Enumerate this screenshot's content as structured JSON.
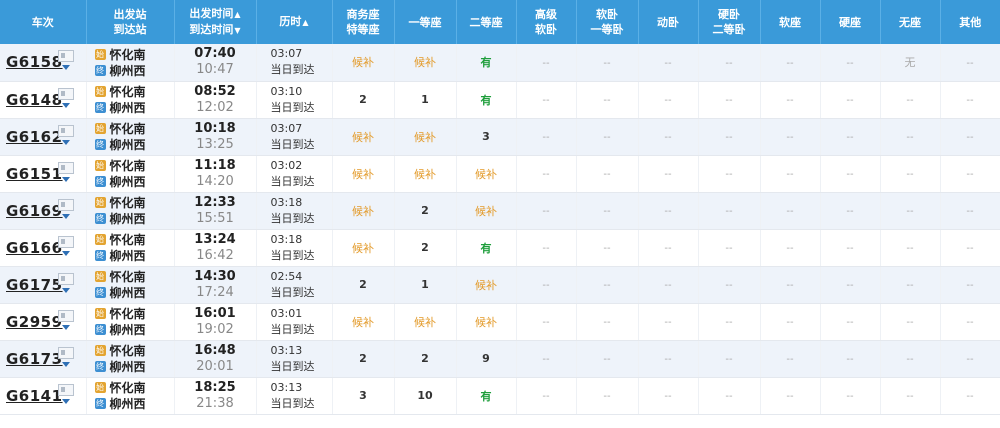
{
  "headers": {
    "train": "车次",
    "station_top": "出发站",
    "station_bottom": "到达站",
    "time_top": "出发时间",
    "time_top_arrow": "▲",
    "time_bottom": "到达时间",
    "time_bottom_arrow": "▼",
    "duration": "历时",
    "duration_arrow": "▲",
    "biz_top": "商务座",
    "biz_bottom": "特等座",
    "first": "一等座",
    "second": "二等座",
    "hsoft_top": "高级",
    "hsoft_bottom": "软卧",
    "soft_top": "软卧",
    "soft_bottom": "一等卧",
    "moving": "动卧",
    "hard_top": "硬卧",
    "hard_bottom": "二等卧",
    "softseat": "软座",
    "hardseat": "硬座",
    "noseat": "无座",
    "other": "其他"
  },
  "trains": [
    {
      "no": "G6158",
      "from": "怀化南",
      "to": "柳州西",
      "from_badge": "始",
      "to_badge": "终",
      "dep": "07:40",
      "arr": "10:47",
      "dur": "03:07",
      "day": "当日到达",
      "biz": "候补",
      "first": "候补",
      "second": "有",
      "hsoft": "--",
      "soft": "--",
      "moving": "--",
      "hard": "--",
      "softseat": "--",
      "hardseat": "--",
      "noseat": "无",
      "other": "--"
    },
    {
      "no": "G6148",
      "from": "怀化南",
      "to": "柳州西",
      "from_badge": "始",
      "to_badge": "终",
      "dep": "08:52",
      "arr": "12:02",
      "dur": "03:10",
      "day": "当日到达",
      "biz": "2",
      "first": "1",
      "second": "有",
      "hsoft": "--",
      "soft": "--",
      "moving": "--",
      "hard": "--",
      "softseat": "--",
      "hardseat": "--",
      "noseat": "--",
      "other": "--"
    },
    {
      "no": "G6162",
      "from": "怀化南",
      "to": "柳州西",
      "from_badge": "始",
      "to_badge": "终",
      "dep": "10:18",
      "arr": "13:25",
      "dur": "03:07",
      "day": "当日到达",
      "biz": "候补",
      "first": "候补",
      "second": "3",
      "hsoft": "--",
      "soft": "--",
      "moving": "--",
      "hard": "--",
      "softseat": "--",
      "hardseat": "--",
      "noseat": "--",
      "other": "--"
    },
    {
      "no": "G6151",
      "from": "怀化南",
      "to": "柳州西",
      "from_badge": "始",
      "to_badge": "终",
      "dep": "11:18",
      "arr": "14:20",
      "dur": "03:02",
      "day": "当日到达",
      "biz": "候补",
      "first": "候补",
      "second": "候补",
      "hsoft": "--",
      "soft": "--",
      "moving": "--",
      "hard": "--",
      "softseat": "--",
      "hardseat": "--",
      "noseat": "--",
      "other": "--"
    },
    {
      "no": "G6169",
      "from": "怀化南",
      "to": "柳州西",
      "from_badge": "始",
      "to_badge": "终",
      "dep": "12:33",
      "arr": "15:51",
      "dur": "03:18",
      "day": "当日到达",
      "biz": "候补",
      "first": "2",
      "second": "候补",
      "hsoft": "--",
      "soft": "--",
      "moving": "--",
      "hard": "--",
      "softseat": "--",
      "hardseat": "--",
      "noseat": "--",
      "other": "--"
    },
    {
      "no": "G6166",
      "from": "怀化南",
      "to": "柳州西",
      "from_badge": "始",
      "to_badge": "终",
      "dep": "13:24",
      "arr": "16:42",
      "dur": "03:18",
      "day": "当日到达",
      "biz": "候补",
      "first": "2",
      "second": "有",
      "hsoft": "--",
      "soft": "--",
      "moving": "--",
      "hard": "--",
      "softseat": "--",
      "hardseat": "--",
      "noseat": "--",
      "other": "--"
    },
    {
      "no": "G6175",
      "from": "怀化南",
      "to": "柳州西",
      "from_badge": "始",
      "to_badge": "终",
      "dep": "14:30",
      "arr": "17:24",
      "dur": "02:54",
      "day": "当日到达",
      "biz": "2",
      "first": "1",
      "second": "候补",
      "hsoft": "--",
      "soft": "--",
      "moving": "--",
      "hard": "--",
      "softseat": "--",
      "hardseat": "--",
      "noseat": "--",
      "other": "--"
    },
    {
      "no": "G2959",
      "from": "怀化南",
      "to": "柳州西",
      "from_badge": "始",
      "to_badge": "终",
      "dep": "16:01",
      "arr": "19:02",
      "dur": "03:01",
      "day": "当日到达",
      "biz": "候补",
      "first": "候补",
      "second": "候补",
      "hsoft": "--",
      "soft": "--",
      "moving": "--",
      "hard": "--",
      "softseat": "--",
      "hardseat": "--",
      "noseat": "--",
      "other": "--"
    },
    {
      "no": "G6173",
      "from": "怀化南",
      "to": "柳州西",
      "from_badge": "始",
      "to_badge": "终",
      "dep": "16:48",
      "arr": "20:01",
      "dur": "03:13",
      "day": "当日到达",
      "biz": "2",
      "first": "2",
      "second": "9",
      "hsoft": "--",
      "soft": "--",
      "moving": "--",
      "hard": "--",
      "softseat": "--",
      "hardseat": "--",
      "noseat": "--",
      "other": "--"
    },
    {
      "no": "G6141",
      "from": "怀化南",
      "to": "柳州西",
      "from_badge": "始",
      "to_badge": "终",
      "dep": "18:25",
      "arr": "21:38",
      "dur": "03:13",
      "day": "当日到达",
      "biz": "3",
      "first": "10",
      "second": "有",
      "hsoft": "--",
      "soft": "--",
      "moving": "--",
      "hard": "--",
      "softseat": "--",
      "hardseat": "--",
      "noseat": "--",
      "other": "--"
    }
  ]
}
